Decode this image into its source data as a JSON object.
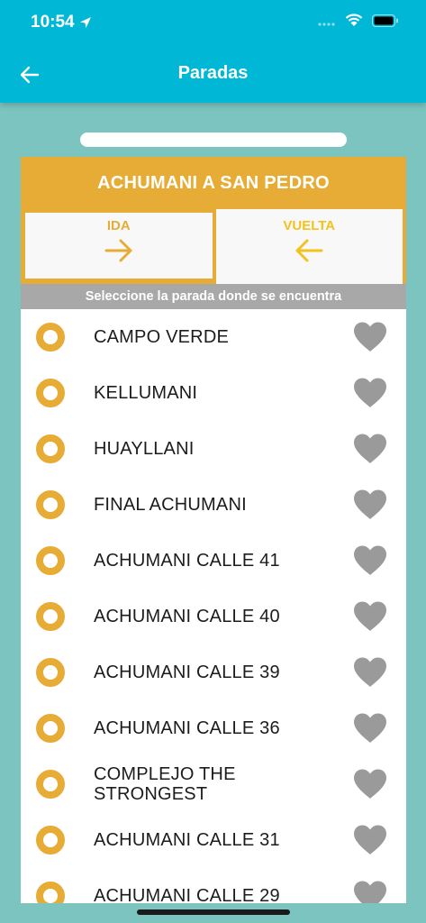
{
  "status_bar": {
    "time": "10:54"
  },
  "header": {
    "title": "Paradas"
  },
  "route": {
    "title": "ACHUMANI A SAN PEDRO",
    "ida_label": "IDA",
    "vuelta_label": "VUELTA",
    "instruction": "Seleccione la parada donde se encuentra"
  },
  "colors": {
    "header": "#00b8d6",
    "background": "#7cc4c0",
    "accent": "#e6ac35",
    "heart": "#9a9a9a"
  },
  "stops": [
    {
      "name": "CAMPO VERDE"
    },
    {
      "name": "KELLUMANI"
    },
    {
      "name": "HUAYLLANI"
    },
    {
      "name": "FINAL ACHUMANI"
    },
    {
      "name": "ACHUMANI CALLE 41"
    },
    {
      "name": "ACHUMANI CALLE 40"
    },
    {
      "name": "ACHUMANI CALLE 39"
    },
    {
      "name": "ACHUMANI CALLE 36"
    },
    {
      "name": "COMPLEJO THE STRONGEST"
    },
    {
      "name": "ACHUMANI CALLE 31"
    },
    {
      "name": "ACHUMANI CALLE 29"
    }
  ]
}
